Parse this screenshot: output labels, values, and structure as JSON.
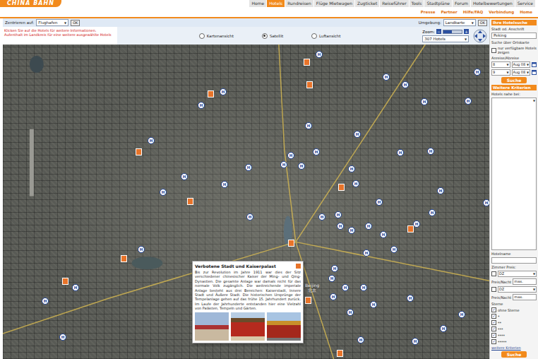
{
  "header": {
    "logo": "CHINA BAHN",
    "tabs": [
      {
        "label": "Home",
        "selected": false
      },
      {
        "label": "Hotels",
        "selected": true
      },
      {
        "label": "Rundreisen",
        "selected": false
      },
      {
        "label": "Flüge Mietwagen",
        "selected": false
      },
      {
        "label": "Zugticket",
        "selected": false
      },
      {
        "label": "Reiseführer",
        "selected": false
      },
      {
        "label": "Tools",
        "selected": false
      },
      {
        "label": "Stadtpläne",
        "selected": false
      },
      {
        "label": "Forum",
        "selected": false
      },
      {
        "label": "Hotelbewertungen",
        "selected": false
      },
      {
        "label": "Service",
        "selected": false
      }
    ],
    "links": [
      "Presse",
      "Partner",
      "Hilfe/FAQ",
      "Verbindung",
      "Home"
    ]
  },
  "toolbar": {
    "center_label": "Zentrieren auf:",
    "center_value": "Flughafen",
    "ok": "OK",
    "hint": "Klicken Sie auf die Hotels für weitere Informationen. Aufenthalt im Landkreis für eine weitere ausgewählte Hotels",
    "views": [
      {
        "label": "Kartenansicht",
        "selected": false
      },
      {
        "label": "Satellit",
        "selected": true
      },
      {
        "label": "Luftansicht",
        "selected": false
      }
    ],
    "surround_label": "Umgebung:",
    "surround_value": "Landkarte",
    "zoom_label": "Zoom:",
    "zoom_minus": "−",
    "zoom_plus": "+",
    "zoom_level": 0.45,
    "show_value": "307 Hotels"
  },
  "map": {
    "city_label": "Beijing",
    "city_label_cn": "北京",
    "pins": [
      {
        "kind": "hotel",
        "label": "H"
      },
      {
        "kind": "hotel",
        "label": "H"
      },
      {
        "kind": "hotel",
        "label": "H"
      },
      {
        "kind": "hotel",
        "label": "H"
      },
      {
        "kind": "hotel",
        "label": "H"
      },
      {
        "kind": "hotel",
        "label": "H"
      },
      {
        "kind": "hotel",
        "label": "H"
      },
      {
        "kind": "hotel",
        "label": "H"
      },
      {
        "kind": "hotel",
        "label": "H"
      },
      {
        "kind": "hotel",
        "label": "H"
      },
      {
        "kind": "hotel",
        "label": "H"
      },
      {
        "kind": "hotel",
        "label": "H"
      },
      {
        "kind": "hotel",
        "label": "H"
      },
      {
        "kind": "hotel",
        "label": "H"
      },
      {
        "kind": "hotel",
        "label": "H"
      },
      {
        "kind": "hotel",
        "label": "H"
      },
      {
        "kind": "hotel",
        "label": "H"
      },
      {
        "kind": "hotel",
        "label": "H"
      },
      {
        "kind": "hotel",
        "label": "H"
      },
      {
        "kind": "hotel",
        "label": "H"
      },
      {
        "kind": "hotel",
        "label": "H"
      },
      {
        "kind": "hotel",
        "label": "H"
      },
      {
        "kind": "hotel",
        "label": "H"
      },
      {
        "kind": "hotel",
        "label": "H"
      },
      {
        "kind": "hotel",
        "label": "H"
      },
      {
        "kind": "hotel",
        "label": "H"
      },
      {
        "kind": "hotel",
        "label": "H"
      },
      {
        "kind": "hotel",
        "label": "H"
      },
      {
        "kind": "hotel",
        "label": "H"
      },
      {
        "kind": "hotel",
        "label": "H"
      },
      {
        "kind": "hotel",
        "label": "H"
      },
      {
        "kind": "hotel",
        "label": "H"
      },
      {
        "kind": "hotel",
        "label": "H"
      },
      {
        "kind": "hotel",
        "label": "H"
      },
      {
        "kind": "hotel",
        "label": "H"
      },
      {
        "kind": "hotel",
        "label": "H"
      },
      {
        "kind": "hotel",
        "label": "H"
      },
      {
        "kind": "hotel",
        "label": "H"
      },
      {
        "kind": "hotel",
        "label": "H"
      },
      {
        "kind": "hotel",
        "label": "H"
      },
      {
        "kind": "hotel",
        "label": "H"
      },
      {
        "kind": "hotel",
        "label": "H"
      },
      {
        "kind": "hotel",
        "label": "H"
      },
      {
        "kind": "hotel",
        "label": "H"
      },
      {
        "kind": "hotel",
        "label": "H"
      },
      {
        "kind": "hotel",
        "label": "H"
      },
      {
        "kind": "hotel",
        "label": "H"
      },
      {
        "kind": "hotel",
        "label": "H"
      },
      {
        "kind": "hotel",
        "label": "H"
      },
      {
        "kind": "hotel",
        "label": "H"
      },
      {
        "kind": "hotel",
        "label": "H"
      },
      {
        "kind": "hotel",
        "label": "H"
      },
      {
        "kind": "hotel",
        "label": "H"
      },
      {
        "kind": "sight",
        "label": ""
      },
      {
        "kind": "sight",
        "label": ""
      },
      {
        "kind": "sight",
        "label": ""
      },
      {
        "kind": "sight",
        "label": ""
      },
      {
        "kind": "sight",
        "label": ""
      },
      {
        "kind": "sight",
        "label": ""
      },
      {
        "kind": "sight",
        "label": ""
      },
      {
        "kind": "sight",
        "label": ""
      },
      {
        "kind": "sight",
        "label": ""
      },
      {
        "kind": "sight",
        "label": ""
      },
      {
        "kind": "sight",
        "label": ""
      },
      {
        "kind": "sight",
        "label": ""
      }
    ],
    "popup": {
      "title": "Verbotene Stadt und Kaiserpalast",
      "text": "Bis zur Revolution im Jahre 1911 war dies der Sitz verschiedener chinesischer Kaiser der Ming- und Qing-Dynastien. Die gesamte Anlage war damals nicht für das normale Volk zugänglich. Die weitreichende imperiale Anlage besteht aus drei Bereichen: Kaiserstadt, Innere Stadt und Äußere Stadt. Die historischen Ursprünge der Tempelanlage gehen auf das frühe 15. Jahrhundert zurück. Im Laufe der Jahrhunderte entstanden hier eine Vielzahl von Palästen, Tempeln und Gärten.",
      "photos": [
        {
          "kind": "square"
        },
        {
          "kind": "gate"
        },
        {
          "kind": "pavilion"
        }
      ]
    }
  },
  "sidebar": {
    "search_title": "Ihre Hotelsuche",
    "city_label": "Stadt od. Anschrift",
    "city_value": "Peking",
    "map_search": "Suche über Ortskarte",
    "available_label": "nur verfügbare Hotels zeigen",
    "available_checked": false,
    "dates_label": "Anreise/Abreise",
    "dates": [
      {
        "day": "8",
        "month": "Aug 08"
      },
      {
        "day": "9",
        "month": "Aug 08"
      }
    ],
    "search_button": "Suche",
    "more_title": "Weitere Kriterien",
    "near_label": "Hotels nahe bei:",
    "name_label": "Hotelname",
    "price_label": "Zimmer Preis:",
    "rooms": [
      {
        "checked": false,
        "type": "DZ",
        "price_label": "Preis/Nacht",
        "max": "max."
      },
      {
        "checked": false,
        "type": "DZ",
        "price_label": "Preis/Nacht",
        "max": "max."
      }
    ],
    "stars_label": "Sterne",
    "stars": [
      {
        "label": "ohne Sterne",
        "checked": true
      },
      {
        "label": "*",
        "checked": true
      },
      {
        "label": "**",
        "checked": true
      },
      {
        "label": "***",
        "checked": true
      },
      {
        "label": "****",
        "checked": true
      },
      {
        "label": "*****",
        "checked": true
      }
    ],
    "more_link": "weitere Kriterien",
    "search_button2": "Suche"
  }
}
